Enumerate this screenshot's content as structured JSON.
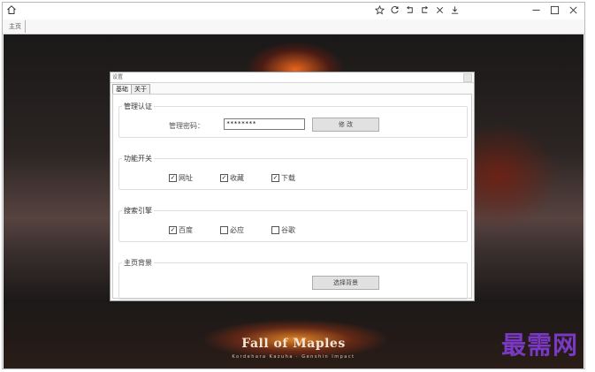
{
  "browser": {
    "tab_home_label": "主页"
  },
  "background": {
    "title": "Fall of Maples",
    "subtitle": "Kordehara Kazuha · Genshin Impact",
    "watermark": "最需网"
  },
  "dialog": {
    "title": "设置",
    "tabs": [
      {
        "label": "基础",
        "active": true
      },
      {
        "label": "关于",
        "active": false
      }
    ],
    "admin": {
      "legend": "管理认证",
      "password_label": "管理密码：",
      "password_value": "********",
      "modify_button": "修  改"
    },
    "features": {
      "legend": "功能开关",
      "items": [
        {
          "label": "网址",
          "checked": true
        },
        {
          "label": "收藏",
          "checked": true
        },
        {
          "label": "下载",
          "checked": true
        }
      ]
    },
    "search": {
      "legend": "搜索引擎",
      "items": [
        {
          "label": "百度",
          "checked": true
        },
        {
          "label": "必应",
          "checked": false
        },
        {
          "label": "谷歌",
          "checked": false
        }
      ]
    },
    "home_bg": {
      "legend": "主页背景",
      "choose_button": "选择背景"
    }
  }
}
